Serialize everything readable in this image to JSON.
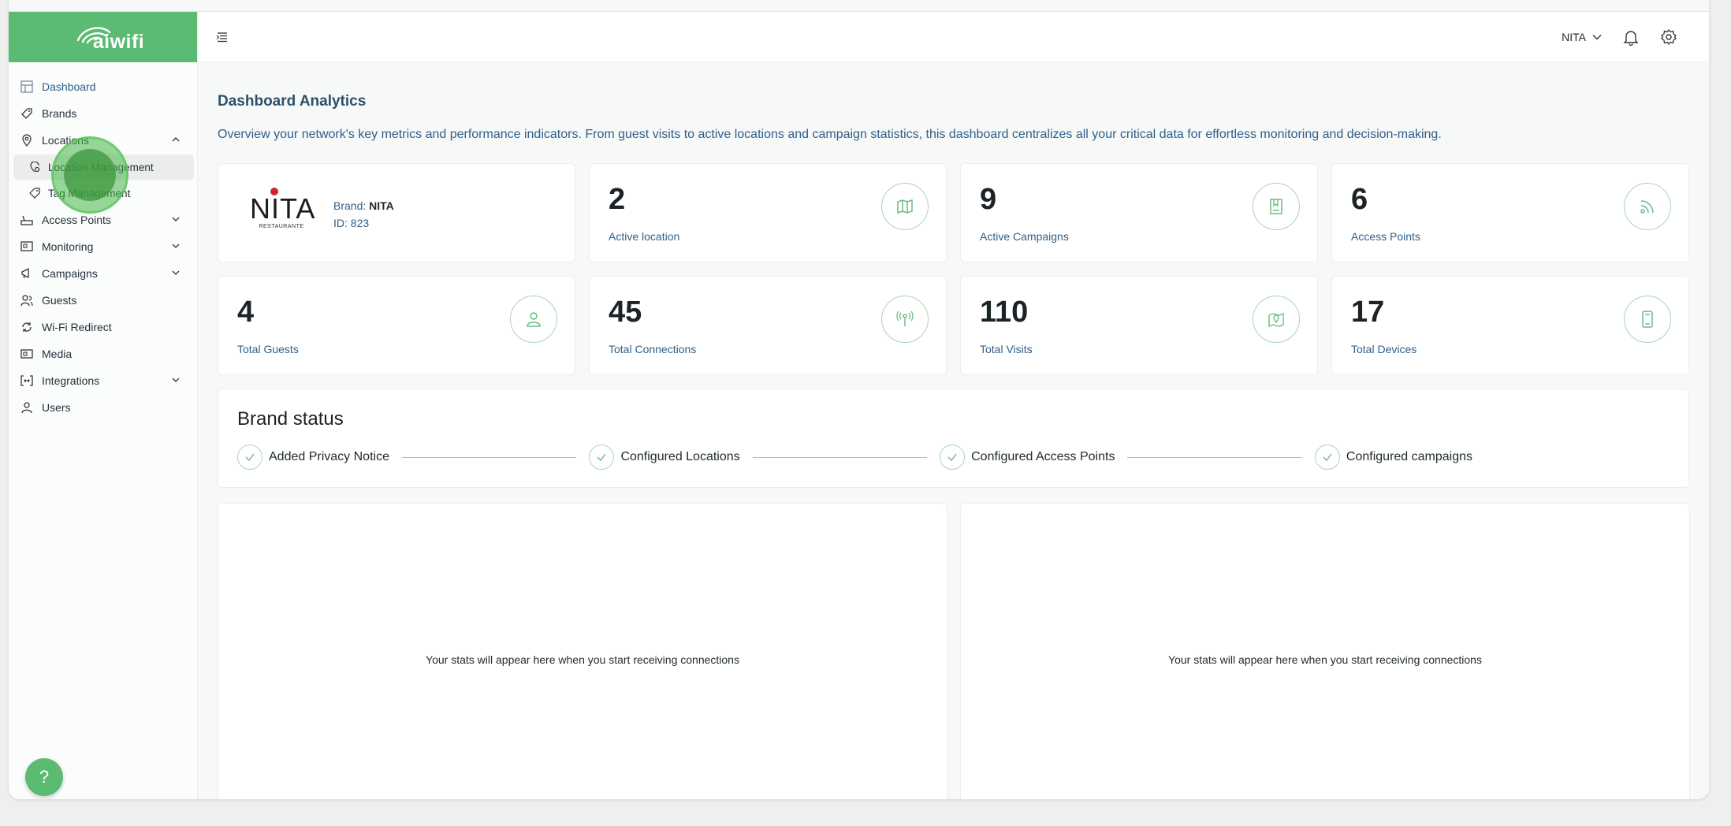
{
  "app": {
    "logo_text": "aiwifi",
    "brand_color": "#5cbb73"
  },
  "sidebar": {
    "items": [
      {
        "label": "Dashboard",
        "icon": "dashboard-icon"
      },
      {
        "label": "Brands",
        "icon": "brands-icon"
      },
      {
        "label": "Locations",
        "icon": "location-pin-icon"
      },
      {
        "label": "Access Points",
        "icon": "router-icon"
      },
      {
        "label": "Monitoring",
        "icon": "monitor-icon"
      },
      {
        "label": "Campaigns",
        "icon": "megaphone-icon"
      },
      {
        "label": "Guests",
        "icon": "guests-icon"
      },
      {
        "label": "Wi-Fi Redirect",
        "icon": "redirect-icon"
      },
      {
        "label": "Media",
        "icon": "media-icon"
      },
      {
        "label": "Integrations",
        "icon": "integrations-icon"
      },
      {
        "label": "Users",
        "icon": "user-icon"
      }
    ],
    "location_sub": [
      {
        "label": "Location Management",
        "icon": "location-settings-icon"
      },
      {
        "label": "Tag Management",
        "icon": "tag-icon"
      }
    ],
    "help_label": "?"
  },
  "header": {
    "user_name": "NITA"
  },
  "main": {
    "title": "Dashboard Analytics",
    "description": "Overview your network's key metrics and performance indicators. From guest visits to active locations and campaign statistics, this dashboard centralizes all your critical data for effortless monitoring and decision-making.",
    "brand": {
      "logo_text": "NITA",
      "logo_sub": "RESTAURANTE",
      "brand_prefix": "Brand: ",
      "brand_name": "NITA",
      "id_text": "ID: 823"
    },
    "stats": [
      {
        "value": "2",
        "label": "Active location",
        "icon": "map-icon"
      },
      {
        "value": "9",
        "label": "Active Campaigns",
        "icon": "book-icon"
      },
      {
        "value": "6",
        "label": "Access Points",
        "icon": "wifi-signal-icon"
      },
      {
        "value": "4",
        "label": "Total Guests",
        "icon": "person-icon"
      },
      {
        "value": "45",
        "label": "Total Connections",
        "icon": "antenna-icon"
      },
      {
        "value": "110",
        "label": "Total Visits",
        "icon": "map-pin-icon"
      },
      {
        "value": "17",
        "label": "Total Devices",
        "icon": "device-icon"
      }
    ],
    "brand_status": {
      "title": "Brand status",
      "steps": [
        "Added Privacy Notice",
        "Configured Locations",
        "Configured Access Points",
        "Configured campaigns"
      ]
    },
    "empty_message_left": "Your stats will appear here when you start receiving connections",
    "empty_message_right": "Your stats will appear here when you start receiving connections"
  }
}
